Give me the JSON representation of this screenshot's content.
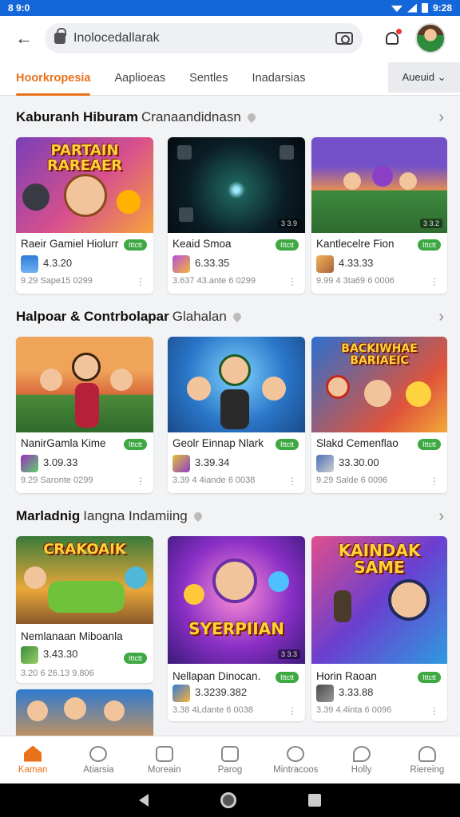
{
  "status": {
    "time_left": "8 9:0",
    "time_right": "9:28"
  },
  "search": {
    "value": "Inolocedallarak"
  },
  "tabs": [
    {
      "label": "Hoorkropesia",
      "active": true
    },
    {
      "label": "Aaplioeas"
    },
    {
      "label": "Sentles"
    },
    {
      "label": "Inadarsias"
    }
  ],
  "tab_more": "Aueuid ⌄",
  "sections": [
    {
      "title": "Kaburanh Hiburam",
      "subtitle": "Cranaandidnasn",
      "cards": [
        {
          "thumb_label": "PARTAIN RAREAER",
          "name": "Raeir Gamiel Hiolurr",
          "badge": "Ittctt",
          "rating": "4.3.20",
          "meta": "9.29   Sape15 0299",
          "tag": ""
        },
        {
          "thumb_label": "",
          "name": "Keaid Smoa",
          "badge": "Ittctt",
          "rating": "6.33.35",
          "meta": "3.637   43.ante 6 0299",
          "tag": "3 3.9"
        },
        {
          "thumb_label": "",
          "name": "Kantlecelre Fion",
          "badge": "Ittctt",
          "rating": "4.33.33",
          "meta": "9.99   4 3ta69 6 0006",
          "tag": "3 3.2"
        }
      ]
    },
    {
      "title": "Halpoar & Contrbolapar",
      "subtitle": "Glahalan",
      "cards": [
        {
          "thumb_label": "",
          "name": "NanirGamla Kime",
          "badge": "Ittctt",
          "rating": "3.09.33",
          "meta": "9.29   Saronte 0299",
          "tag": ""
        },
        {
          "thumb_label": "",
          "name": "Geolr Einnap Nlark",
          "badge": "Ittctt",
          "rating": "3.39.34",
          "meta": "3.39   4 4iande 6 0038",
          "tag": ""
        },
        {
          "thumb_label": "BACKIWHAE BARIAEIC",
          "name": "Slakd Cemenflao",
          "badge": "Ittctt",
          "rating": "33.30.00",
          "meta": "9.29   Salde 6 0096",
          "tag": ""
        }
      ]
    },
    {
      "title": "Marladnig",
      "subtitle": "Iangna Indamiing",
      "cards": [
        {
          "thumb_label": "CRAKOAIK",
          "name": "Nemlanaan Miboanlan",
          "badge": "Ittctt",
          "rating": "3.43.30",
          "meta": "3.20   6 26.13 9.806",
          "tag": ""
        },
        {
          "thumb_label": "SYERPIIAN",
          "name": "Nellapan Dinocan.",
          "badge": "Ittctt",
          "rating": "3.3239.382",
          "meta": "3.38   4Ldante 6 0038",
          "tag": "3 3.3"
        },
        {
          "thumb_label": "KAINDAK SAME",
          "name": "Horin Raoan",
          "badge": "Ittctt",
          "rating": "3.33.88",
          "meta": "3.39   4.4inta 6 0096",
          "tag": ""
        }
      ]
    }
  ],
  "nav": [
    {
      "label": "Kaman",
      "active": true
    },
    {
      "label": "Atiarsia"
    },
    {
      "label": "Moreain"
    },
    {
      "label": "Parog"
    },
    {
      "label": "Mintracoos"
    },
    {
      "label": "Holly"
    },
    {
      "label": "Riereing"
    }
  ],
  "colors": {
    "accent": "#e8711a",
    "status_bar": "#1467d8",
    "badge_green": "#3ea843"
  }
}
